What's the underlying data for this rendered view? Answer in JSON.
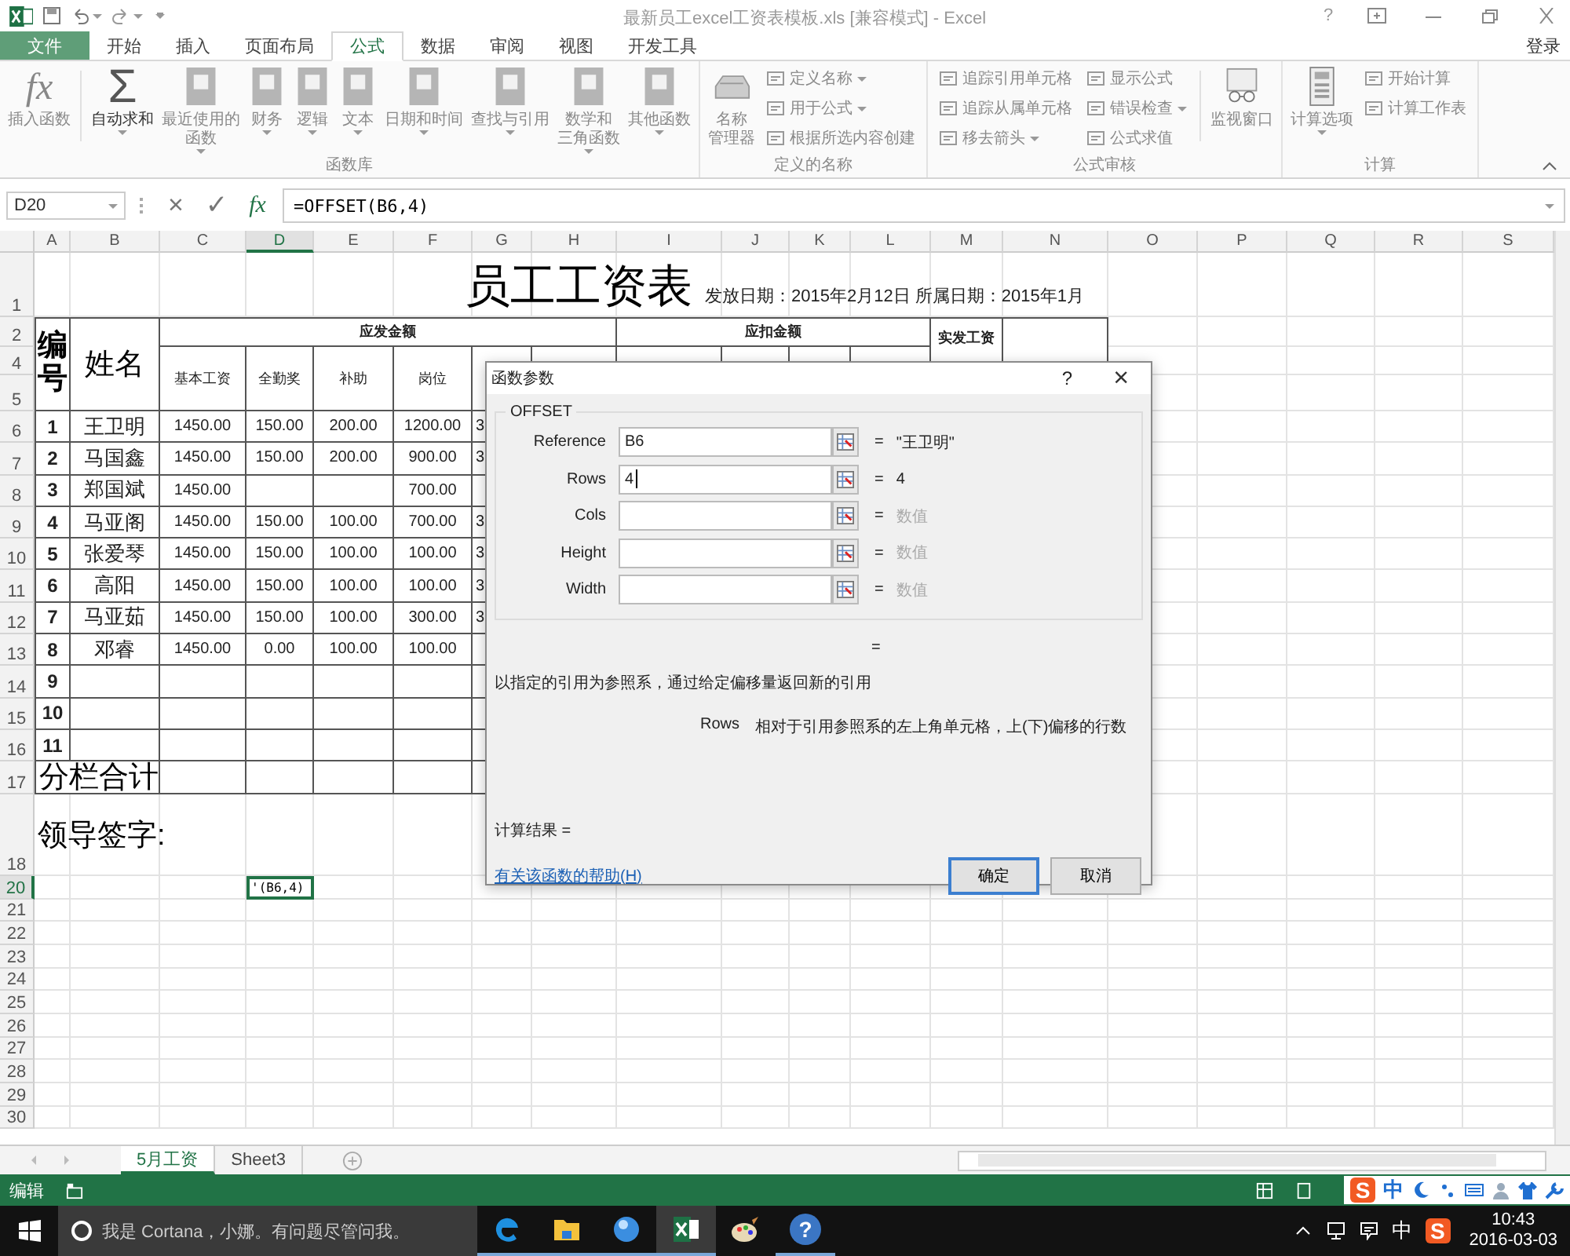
{
  "window": {
    "title": "最新员工excel工资表模板.xls  [兼容模式] - Excel",
    "help": "?",
    "signin": "登录"
  },
  "tabs": [
    {
      "label": "文件",
      "kind": "file",
      "selected": false
    },
    {
      "label": "开始",
      "kind": "tab",
      "selected": false
    },
    {
      "label": "插入",
      "kind": "tab",
      "selected": false
    },
    {
      "label": "页面布局",
      "kind": "tab",
      "selected": false
    },
    {
      "label": "公式",
      "kind": "tab",
      "selected": true
    },
    {
      "label": "数据",
      "kind": "tab",
      "selected": false
    },
    {
      "label": "审阅",
      "kind": "tab",
      "selected": false
    },
    {
      "label": "视图",
      "kind": "tab",
      "selected": false
    },
    {
      "label": "开发工具",
      "kind": "tab",
      "selected": false
    }
  ],
  "ribbon": {
    "groups": [
      {
        "label": "函数库",
        "items": [
          {
            "kind": "glyph",
            "lines": [
              "插入函数"
            ],
            "glyph": "fx",
            "dropdown": false
          },
          {
            "kind": "separator"
          },
          {
            "kind": "glyph",
            "lines": [
              "自动求和"
            ],
            "glyph": "Σ",
            "dropdown": true
          },
          {
            "kind": "book",
            "lines": [
              "最近使用的",
              "函数"
            ],
            "dropdown": true
          },
          {
            "kind": "book",
            "lines": [
              "财务"
            ],
            "dropdown": true
          },
          {
            "kind": "book",
            "lines": [
              "逻辑"
            ],
            "dropdown": true
          },
          {
            "kind": "book",
            "lines": [
              "文本"
            ],
            "dropdown": true
          },
          {
            "kind": "book",
            "lines": [
              "日期和时间"
            ],
            "dropdown": true
          },
          {
            "kind": "book",
            "lines": [
              "查找与引用"
            ],
            "dropdown": true
          },
          {
            "kind": "book",
            "lines": [
              "数学和",
              "三角函数"
            ],
            "dropdown": true
          },
          {
            "kind": "book",
            "lines": [
              "其他函数"
            ],
            "dropdown": true
          }
        ]
      },
      {
        "label": "定义的名称",
        "items": [
          {
            "kind": "cards",
            "lines": [
              "名称",
              "管理器"
            ],
            "dropdown": false
          },
          {
            "kind": "column",
            "buttons": [
              {
                "label": "定义名称",
                "dropdown": true
              },
              {
                "label": "用于公式",
                "dropdown": true
              },
              {
                "label": "根据所选内容创建",
                "dropdown": false
              }
            ]
          }
        ]
      },
      {
        "label": "公式审核",
        "items": [
          {
            "kind": "column",
            "buttons": [
              {
                "label": "追踪引用单元格",
                "dropdown": false
              },
              {
                "label": "追踪从属单元格",
                "dropdown": false
              },
              {
                "label": "移去箭头",
                "dropdown": true
              }
            ]
          },
          {
            "kind": "column",
            "buttons": [
              {
                "label": "显示公式",
                "dropdown": false
              },
              {
                "label": "错误检查",
                "dropdown": true
              },
              {
                "label": "公式求值",
                "dropdown": false
              }
            ]
          },
          {
            "kind": "separator"
          },
          {
            "kind": "watch",
            "lines": [
              "监视窗口"
            ],
            "dropdown": false
          }
        ]
      },
      {
        "label": "计算",
        "items": [
          {
            "kind": "calculator",
            "lines": [
              "计算选项"
            ],
            "dropdown": true
          },
          {
            "kind": "column",
            "buttons": [
              {
                "label": "开始计算",
                "dropdown": false
              },
              {
                "label": "计算工作表",
                "dropdown": false
              }
            ]
          }
        ]
      }
    ]
  },
  "formula_bar": {
    "name_box": "D20",
    "cancel": "×",
    "enter": "✓",
    "fx": "fx",
    "formula": "=OFFSET(B6,4)"
  },
  "sheet": {
    "columns": [
      {
        "label": "A",
        "selected": false
      },
      {
        "label": "B",
        "selected": false
      },
      {
        "label": "C",
        "selected": false
      },
      {
        "label": "D",
        "selected": true
      },
      {
        "label": "E",
        "selected": false
      },
      {
        "label": "F",
        "selected": false
      },
      {
        "label": "G",
        "selected": false
      },
      {
        "label": "H",
        "selected": false
      },
      {
        "label": "I",
        "selected": false
      },
      {
        "label": "J",
        "selected": false
      },
      {
        "label": "K",
        "selected": false
      },
      {
        "label": "L",
        "selected": false
      },
      {
        "label": "M",
        "selected": false
      },
      {
        "label": "N",
        "selected": false
      },
      {
        "label": "O",
        "selected": false
      },
      {
        "label": "P",
        "selected": false
      },
      {
        "label": "Q",
        "selected": false
      },
      {
        "label": "R",
        "selected": false
      },
      {
        "label": "S",
        "selected": false
      }
    ],
    "rows": [
      {
        "label": "1",
        "selected": false
      },
      {
        "label": "2",
        "selected": false
      },
      {
        "label": "4",
        "selected": false
      },
      {
        "label": "5",
        "selected": false
      },
      {
        "label": "6",
        "selected": false
      },
      {
        "label": "7",
        "selected": false
      },
      {
        "label": "8",
        "selected": false
      },
      {
        "label": "9",
        "selected": false
      },
      {
        "label": "10",
        "selected": false
      },
      {
        "label": "11",
        "selected": false
      },
      {
        "label": "12",
        "selected": false
      },
      {
        "label": "13",
        "selected": false
      },
      {
        "label": "14",
        "selected": false
      },
      {
        "label": "15",
        "selected": false
      },
      {
        "label": "16",
        "selected": false
      },
      {
        "label": "17",
        "selected": false
      },
      {
        "label": "18",
        "selected": false
      },
      {
        "label": "20",
        "selected": true
      },
      {
        "label": "21",
        "selected": false
      },
      {
        "label": "22",
        "selected": false
      },
      {
        "label": "23",
        "selected": false
      },
      {
        "label": "24",
        "selected": false
      },
      {
        "label": "25",
        "selected": false
      },
      {
        "label": "26",
        "selected": false
      },
      {
        "label": "27",
        "selected": false
      },
      {
        "label": "28",
        "selected": false
      },
      {
        "label": "29",
        "selected": false
      },
      {
        "label": "30",
        "selected": false
      }
    ],
    "title": "员工工资表",
    "issue_info": "发放日期：2015年2月12日 所属日期：2015年1月",
    "header": {
      "number_label": "编号",
      "name_label": "姓名",
      "earning_group": "应发金额",
      "deduction_group": "应扣金额",
      "net_label": "实发工资",
      "sub_columns": [
        "基本工资",
        "全勤奖",
        "补助",
        "岗位"
      ]
    },
    "records": [
      {
        "no": "1",
        "name": "王卫明",
        "basic": "1450.00",
        "attendance": "150.00",
        "allowance": "200.00",
        "post": "1200.00",
        "column_g": "3"
      },
      {
        "no": "2",
        "name": "马国鑫",
        "basic": "1450.00",
        "attendance": "150.00",
        "allowance": "200.00",
        "post": "900.00",
        "column_g": "3"
      },
      {
        "no": "3",
        "name": "郑国斌",
        "basic": "1450.00",
        "post": "700.00"
      },
      {
        "no": "4",
        "name": "马亚阁",
        "basic": "1450.00",
        "attendance": "150.00",
        "allowance": "100.00",
        "post": "700.00",
        "column_g": "3"
      },
      {
        "no": "5",
        "name": "张爱琴",
        "basic": "1450.00",
        "attendance": "150.00",
        "allowance": "100.00",
        "post": "100.00",
        "column_g": "3"
      },
      {
        "no": "6",
        "name": "高阳",
        "basic": "1450.00",
        "attendance": "150.00",
        "allowance": "100.00",
        "post": "100.00",
        "column_g": "3"
      },
      {
        "no": "7",
        "name": "马亚茹",
        "basic": "1450.00",
        "attendance": "150.00",
        "allowance": "100.00",
        "post": "300.00",
        "column_g": "3"
      },
      {
        "no": "8",
        "name": "邓睿",
        "basic": "1450.00",
        "attendance": "0.00",
        "allowance": "100.00",
        "post": "100.00"
      }
    ],
    "blank_numbers": [
      "9",
      "10",
      "11"
    ],
    "total_label": "分栏合计",
    "sign_label": "领导签字:",
    "active_cell": "'(B6,4)"
  },
  "dialog": {
    "title": "函数参数",
    "help": "?",
    "close": "×",
    "function": "OFFSET",
    "args": [
      {
        "label": "Reference",
        "value": "B6",
        "result": "\"王卫明\"",
        "result_muted": false,
        "focused": false
      },
      {
        "label": "Rows",
        "value": "4",
        "result": "4",
        "result_muted": false,
        "focused": true
      },
      {
        "label": "Cols",
        "result": "数值",
        "result_muted": true,
        "focused": false
      },
      {
        "label": "Height",
        "result": "数值",
        "result_muted": true,
        "focused": false
      },
      {
        "label": "Width",
        "result": "数值",
        "result_muted": true,
        "focused": false
      }
    ],
    "equals": "=",
    "description": "以指定的引用为参照系，通过给定偏移量返回新的引用",
    "arg_name": "Rows",
    "arg_help": "相对于引用参照系的左上角单元格，上(下)偏移的行数",
    "result_label": "计算结果 =",
    "help_link": "有关该函数的帮助(H)",
    "buttons": [
      {
        "label": "确定",
        "default": true
      },
      {
        "label": "取消",
        "default": false
      }
    ]
  },
  "sheet_tabs": [
    {
      "label": "5月工资",
      "selected": true
    },
    {
      "label": "Sheet3",
      "selected": false
    }
  ],
  "status_bar": {
    "mode": "编辑",
    "ime_logo": "S",
    "ime_lang": "中"
  },
  "taskbar": {
    "search_placeholder": "我是 Cortana，小娜。有问题尽管问我。",
    "apps": [
      {
        "kind": "edge",
        "running": true,
        "active": false
      },
      {
        "kind": "folder",
        "running": true,
        "active": false
      },
      {
        "kind": "globe",
        "running": true,
        "active": false
      },
      {
        "kind": "excel",
        "running": true,
        "active": true
      },
      {
        "kind": "paint",
        "running": false,
        "active": false
      },
      {
        "kind": "help",
        "running": true,
        "active": false,
        "glyph": "?"
      }
    ],
    "tray_lang": "中",
    "tray_logo": "S",
    "time": "10:43",
    "date": "2016-03-03"
  }
}
